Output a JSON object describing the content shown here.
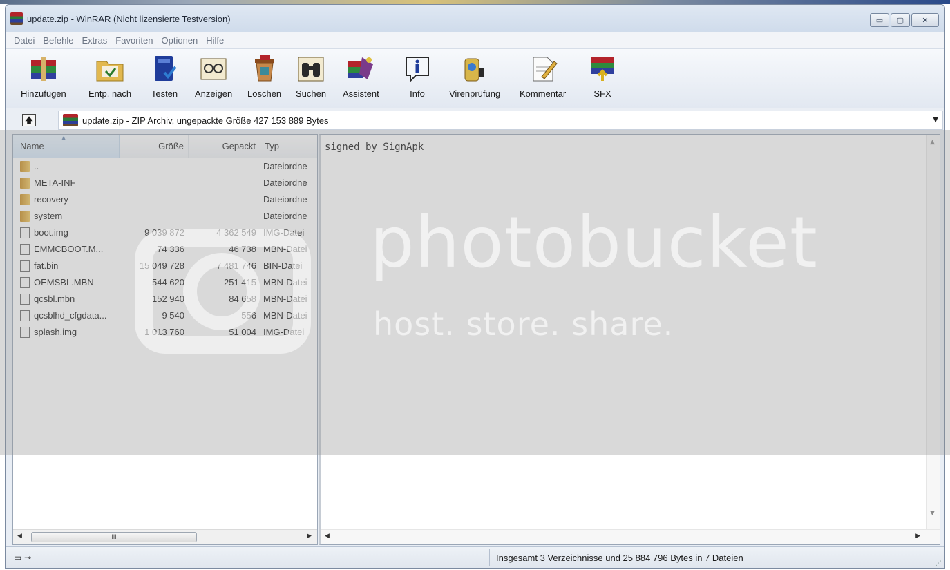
{
  "window": {
    "title": "update.zip - WinRAR (Nicht lizensierte Testversion)",
    "buttons": {
      "minimize": "▭",
      "maximize": "▢",
      "close": "✕"
    }
  },
  "menu": [
    "Datei",
    "Befehle",
    "Extras",
    "Favoriten",
    "Optionen",
    "Hilfe"
  ],
  "toolbar": [
    {
      "label": "Hinzufügen",
      "icon": "books-add-icon"
    },
    {
      "label": "Entp. nach",
      "icon": "extract-folder-icon"
    },
    {
      "label": "Testen",
      "icon": "test-book-icon"
    },
    {
      "label": "Anzeigen",
      "icon": "view-glasses-icon"
    },
    {
      "label": "Löschen",
      "icon": "delete-bin-icon"
    },
    {
      "label": "Suchen",
      "icon": "binoculars-icon"
    },
    {
      "label": "Assistent",
      "icon": "wizard-icon"
    },
    {
      "label": "Info",
      "icon": "info-icon"
    },
    {
      "label": "Virenprüfung",
      "icon": "virus-scan-icon"
    },
    {
      "label": "Kommentar",
      "icon": "comment-pen-icon"
    },
    {
      "label": "SFX",
      "icon": "sfx-archive-icon"
    }
  ],
  "address": {
    "up_symbol": "🡅",
    "path": "update.zip - ZIP Archiv, ungepackte Größe 427 153 889 Bytes"
  },
  "columns": {
    "name": "Name",
    "size": "Größe",
    "packed": "Gepackt",
    "type": "Typ"
  },
  "files": [
    {
      "name": "..",
      "size": "",
      "packed": "",
      "type": "Dateiordne",
      "kind": "folder"
    },
    {
      "name": "META-INF",
      "size": "",
      "packed": "",
      "type": "Dateiordne",
      "kind": "folder"
    },
    {
      "name": "recovery",
      "size": "",
      "packed": "",
      "type": "Dateiordne",
      "kind": "folder"
    },
    {
      "name": "system",
      "size": "",
      "packed": "",
      "type": "Dateiordne",
      "kind": "folder"
    },
    {
      "name": "boot.img",
      "size": "9 039 872",
      "packed": "4 362 549",
      "type": "IMG-Datei",
      "kind": "file"
    },
    {
      "name": "EMMCBOOT.M...",
      "size": "74 336",
      "packed": "46 738",
      "type": "MBN-Datei",
      "kind": "file"
    },
    {
      "name": "fat.bin",
      "size": "15 049 728",
      "packed": "7 481 746",
      "type": "BIN-Datei",
      "kind": "file"
    },
    {
      "name": "OEMSBL.MBN",
      "size": "544 620",
      "packed": "251 415",
      "type": "MBN-Datei",
      "kind": "file"
    },
    {
      "name": "qcsbl.mbn",
      "size": "152 940",
      "packed": "84 658",
      "type": "MBN-Datei",
      "kind": "file"
    },
    {
      "name": "qcsblhd_cfgdata...",
      "size": "9 540",
      "packed": "556",
      "type": "MBN-Datei",
      "kind": "file"
    },
    {
      "name": "splash.img",
      "size": "1 013 760",
      "packed": "51 004",
      "type": "IMG-Datei",
      "kind": "file"
    }
  ],
  "scrollbar": {
    "thumb_grip": "III",
    "left": "◀",
    "right": "▶"
  },
  "comment": "signed by SignApk",
  "status": {
    "indicator": "▭ ⊸",
    "text": "Insgesamt 3 Verzeichnisse und 25 884 796 Bytes in 7 Dateien"
  },
  "watermark": {
    "brand": "photobucket",
    "tagline": "host. store. share."
  }
}
